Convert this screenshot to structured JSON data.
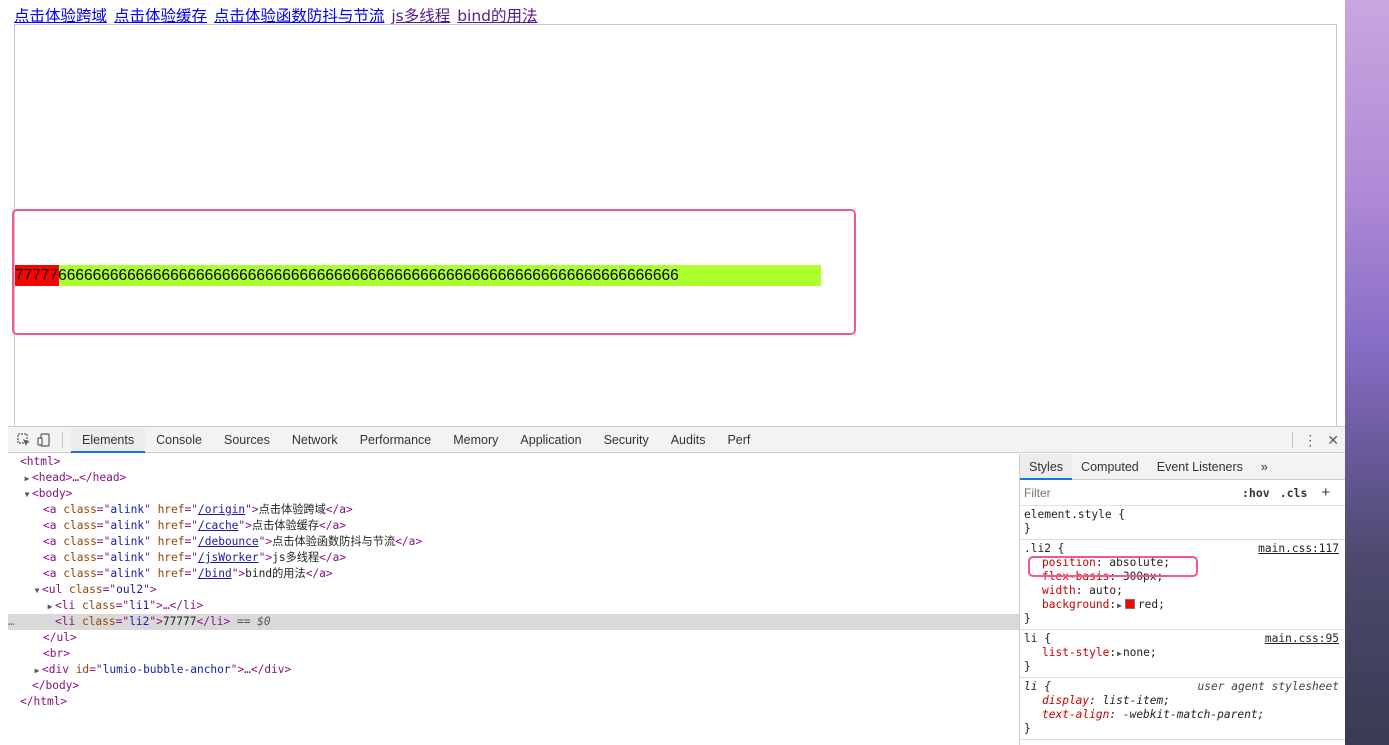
{
  "page": {
    "links": [
      "点击体验跨域",
      "点击体验缓存",
      "点击体验函数防抖与节流",
      "js多线程",
      "bind的用法"
    ],
    "li2_text": "77777",
    "li1_text": "66666666666666666666666666666666666666666666666666666666666666666666666666666"
  },
  "devtools": {
    "tabs": [
      "Elements",
      "Console",
      "Sources",
      "Network",
      "Performance",
      "Memory",
      "Application",
      "Security",
      "Audits",
      "Perf"
    ],
    "active_tab": "Elements",
    "elements": {
      "html_open": "<html>",
      "head": "<head>…</head>",
      "body_open": "<body>",
      "anchors": [
        {
          "href": "/origin",
          "text": "点击体验跨域"
        },
        {
          "href": "/cache",
          "text": "点击体验缓存"
        },
        {
          "href": "/debounce",
          "text": "点击体验函数防抖与节流"
        },
        {
          "href": "/jsWorker",
          "text": "js多线程"
        },
        {
          "href": "/bind",
          "text": "bind的用法"
        }
      ],
      "anchor_class": "alink",
      "ul_class": "oul2",
      "li1_class": "li1",
      "li2_class": "li2",
      "li2_text": "77777",
      "selected_suffix": "== $0",
      "div_id": "lumio-bubble-anchor"
    },
    "styles": {
      "tabs": [
        "Styles",
        "Computed",
        "Event Listeners"
      ],
      "more": "»",
      "filter_placeholder": "Filter",
      "hov": ":hov",
      "cls": ".cls",
      "element_style": "element.style {",
      "rules": [
        {
          "selector": ".li2 {",
          "source": "main.css:117",
          "props": [
            {
              "name": "position",
              "value": "absolute;"
            },
            {
              "name": "flex-basis",
              "value": "300px;"
            },
            {
              "name": "width",
              "value": "auto;"
            },
            {
              "name": "background",
              "value": "red;"
            }
          ]
        },
        {
          "selector": "li {",
          "source": "main.css:95",
          "props": [
            {
              "name": "list-style",
              "value": "none;"
            }
          ]
        },
        {
          "selector": "li {",
          "source": "user agent stylesheet",
          "props": [
            {
              "name": "display",
              "value": "list-item;"
            },
            {
              "name": "text-align",
              "value": "-webkit-match-parent;"
            }
          ]
        }
      ]
    }
  }
}
